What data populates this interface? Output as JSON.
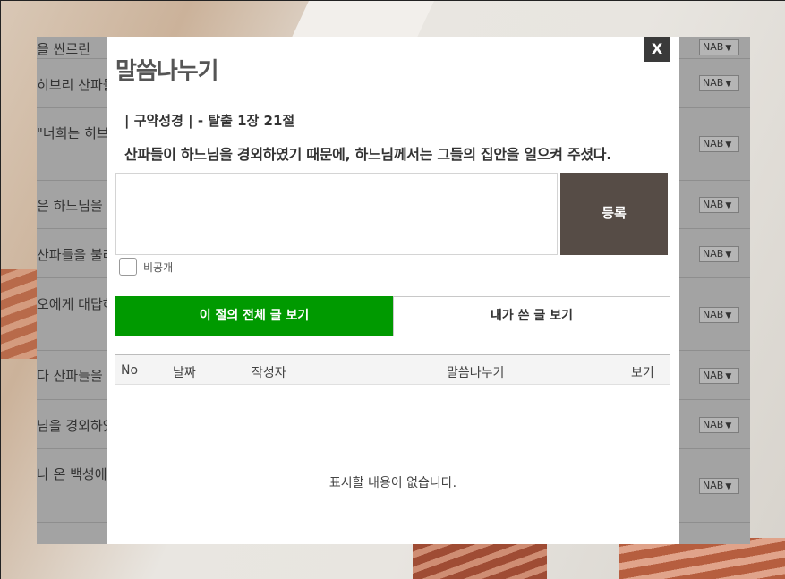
{
  "background_list": {
    "rows": [
      {
        "text": "을 싼르린",
        "nab": "NAB"
      },
      {
        "text": "히브리 산파들",
        "nab": "NAB"
      },
      {
        "text": "\"너희는 히브",
        "nab": "NAB"
      },
      {
        "text": "은 하느님을 경",
        "nab": "NAB"
      },
      {
        "text": "산파들을 불러",
        "nab": "NAB"
      },
      {
        "text": "오에게 대답하",
        "nab": "NAB"
      },
      {
        "text": "다 산파들을 잘",
        "nab": "NAB"
      },
      {
        "text": "님을 경외하였",
        "nab": "NAB"
      },
      {
        "text": "나 온 백성에게",
        "nab": "NAB"
      }
    ]
  },
  "modal": {
    "close_label": "X",
    "title": "말씀나누기",
    "verse_ref": "| 구약성경 | - 탈출 1장 21절",
    "verse_text": "산파들이 하느님을 경외하였기 때문에, 하느님께서는 그들의 집안을 일으켜 주셨다.",
    "comment_value": "",
    "submit_label": "등록",
    "private_label": "비공개",
    "private_checked": false,
    "tabs": [
      {
        "label": "이 절의 전체 글 보기",
        "active": true
      },
      {
        "label": "내가 쓴 글 보기",
        "active": false
      }
    ],
    "table": {
      "headers": [
        "No",
        "날짜",
        "작성자",
        "말씀나누기",
        "보기"
      ],
      "empty_message": "표시할 내용이 없습니다."
    }
  },
  "colors": {
    "active_tab": "#009a00",
    "submit_button": "#564c46",
    "close_button": "#3a3a3a",
    "overlay_panel": "#a3a3a3"
  }
}
